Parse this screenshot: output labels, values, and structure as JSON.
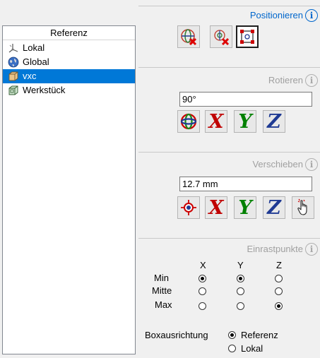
{
  "reference": {
    "header": "Referenz",
    "items": [
      {
        "label": "Lokal",
        "icon": "local-axes-icon",
        "selected": false
      },
      {
        "label": "Global",
        "icon": "globe-icon",
        "selected": false
      },
      {
        "label": "vxc",
        "icon": "part-box-icon",
        "selected": true
      },
      {
        "label": "Werkstück",
        "icon": "workpiece-icon",
        "selected": false
      }
    ]
  },
  "positionieren": {
    "title": "Positionieren",
    "buttons": [
      "reset-global-icon",
      "reset-local-icon",
      "bounding-box-icon"
    ],
    "active_button": "bounding-box-icon"
  },
  "rotieren": {
    "title": "Rotieren",
    "value": "90°",
    "buttons": [
      "rotate-gizmo-icon",
      "X",
      "Y",
      "Z"
    ]
  },
  "verschieben": {
    "title": "Verschieben",
    "value": "12.7 mm",
    "buttons": [
      "target-icon",
      "X",
      "Y",
      "Z",
      "hand-pointer-icon"
    ]
  },
  "einrastpunkte": {
    "title": "Einrastpunkte",
    "columns": [
      "X",
      "Y",
      "Z"
    ],
    "rows": [
      {
        "label": "Min",
        "selected": [
          true,
          true,
          false
        ]
      },
      {
        "label": "Mitte",
        "selected": [
          false,
          false,
          false
        ]
      },
      {
        "label": "Max",
        "selected": [
          false,
          false,
          true
        ]
      }
    ]
  },
  "boxausrichtung": {
    "label": "Boxausrichtung",
    "options": [
      {
        "label": "Referenz",
        "selected": true
      },
      {
        "label": "Lokal",
        "selected": false
      }
    ]
  },
  "colors": {
    "accent_blue": "#0066cc",
    "selection": "#0078d7",
    "axis_x": "#c00000",
    "axis_y": "#008000",
    "axis_z": "#1f3a93"
  }
}
